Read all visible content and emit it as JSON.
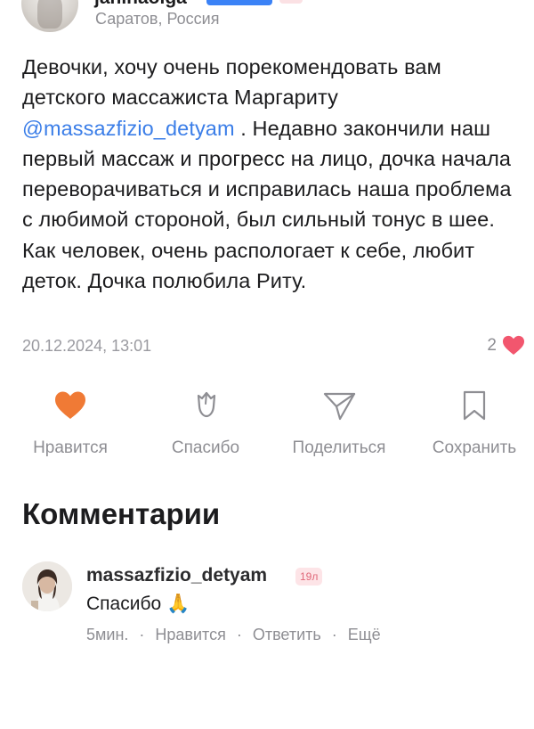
{
  "author": {
    "name": "janinaolga",
    "location": "Саратов, Россия"
  },
  "post": {
    "text_before": "Девочки, хочу очень порекомендовать вам детского массажиста Маргариту ",
    "mention": "@massazfizio_detyam",
    "text_after": " . Недавно закончили наш первый массаж и прогресс на лицо, дочка начала переворачиваться и исправилась наша проблема с любимой стороной, был сильный тонус в шее. Как человек, очень распологает к себе, любит деток. Дочка полюбила Риту.",
    "date": "20.12.2024, 13:01",
    "likes_count": "2"
  },
  "actions": {
    "like": {
      "label": "Нравится",
      "icon": "heart-icon"
    },
    "thanks": {
      "label": "Спасибо",
      "icon": "tulip-icon"
    },
    "share": {
      "label": "Поделиться",
      "icon": "paper-plane-icon"
    },
    "save": {
      "label": "Сохранить",
      "icon": "bookmark-icon"
    }
  },
  "comments": {
    "title": "Комментарии",
    "items": [
      {
        "username": "massazfizio_detyam",
        "age_badge": "19л",
        "text": "Спасибо 🙏",
        "time": "5мин.",
        "like_label": "Нравится",
        "reply_label": "Ответить",
        "more_label": "Ещё"
      }
    ]
  },
  "colors": {
    "accent_link": "#3b7ee8",
    "heart_orange": "#f07a35",
    "heart_pink": "#f2566e",
    "muted": "#8e8e93"
  }
}
